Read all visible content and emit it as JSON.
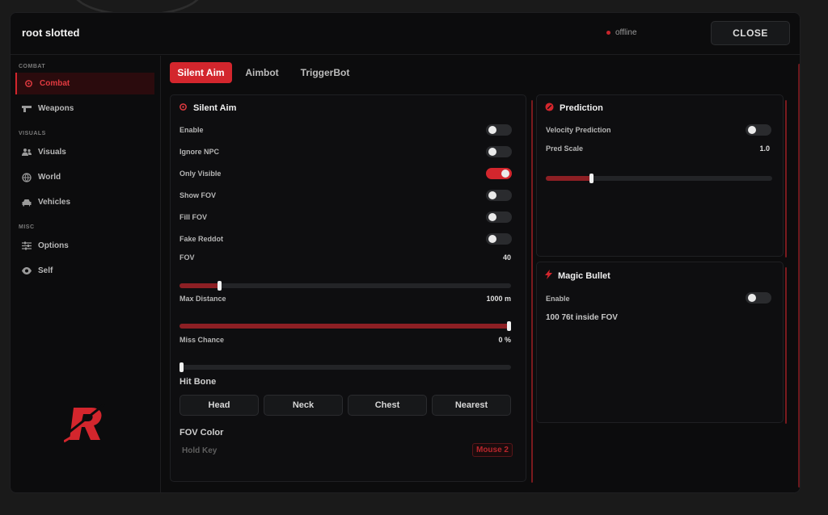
{
  "window": {
    "title": "root slotted",
    "status": "offline",
    "close_label": "CLOSE"
  },
  "sidebar": {
    "sections": [
      {
        "label": "COMBAT"
      },
      {
        "label": "VISUALS"
      },
      {
        "label": "MISC"
      }
    ],
    "items": [
      {
        "label": "Combat",
        "icon": "crosshair-icon",
        "active": true
      },
      {
        "label": "Weapons",
        "icon": "gun-icon"
      },
      {
        "label": "Visuals",
        "icon": "users-icon"
      },
      {
        "label": "World",
        "icon": "globe-icon"
      },
      {
        "label": "Vehicles",
        "icon": "car-icon"
      },
      {
        "label": "Options",
        "icon": "sliders-icon"
      },
      {
        "label": "Self",
        "icon": "eye-icon"
      }
    ]
  },
  "tabs": [
    {
      "label": "Silent Aim",
      "active": true
    },
    {
      "label": "Aimbot"
    },
    {
      "label": "TriggerBot"
    }
  ],
  "silent_aim": {
    "title": "Silent Aim",
    "toggles": [
      {
        "label": "Enable",
        "on": false
      },
      {
        "label": "Ignore NPC",
        "on": false
      },
      {
        "label": "Only Visible",
        "on": true
      },
      {
        "label": "Show FOV",
        "on": false
      },
      {
        "label": "Fill FOV",
        "on": false
      },
      {
        "label": "Fake Reddot",
        "on": false
      }
    ],
    "sliders": [
      {
        "label": "FOV",
        "value": "40",
        "fraction": 0.12
      },
      {
        "label": "Max Distance",
        "value": "1000 m",
        "fraction": 1.0
      },
      {
        "label": "Miss Chance",
        "value": "0 %",
        "fraction": 0.0
      }
    ],
    "hit_bone_label": "Hit Bone",
    "hit_bones": [
      "Head",
      "Neck",
      "Chest",
      "Nearest"
    ],
    "fov_color_label": "FOV Color",
    "hold_key_label": "Hold Key",
    "hold_key_value": "Mouse 2"
  },
  "prediction": {
    "title": "Prediction",
    "velocity_label": "Velocity Prediction",
    "velocity_on": false,
    "pred_scale_label": "Pred Scale",
    "pred_scale_value": "1.0",
    "pred_scale_fraction": 0.2
  },
  "magic_bullet": {
    "title": "Magic Bullet",
    "enable_label": "Enable",
    "enable_on": false,
    "info": "100 76t inside FOV"
  },
  "colors": {
    "accent": "#d3262d",
    "background": "#0c0c0d"
  }
}
